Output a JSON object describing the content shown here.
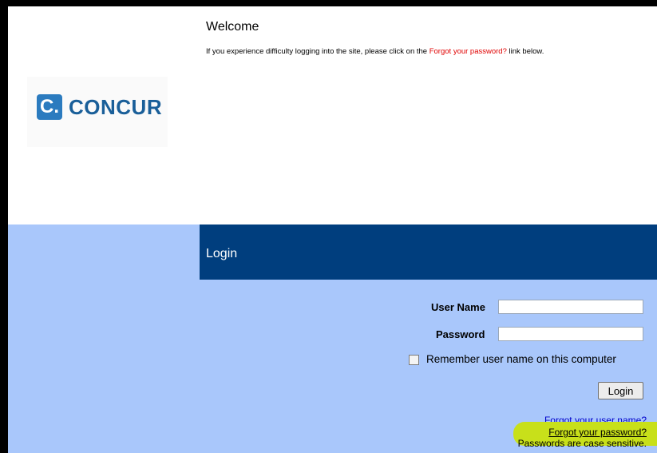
{
  "brand": {
    "logo_letter": "C.",
    "logo_text": "CONCUR"
  },
  "welcome": {
    "title": "Welcome",
    "text_before": "If you experience difficulty logging into the site, please click on the ",
    "link": "Forgot your password?",
    "text_after": " link below."
  },
  "login": {
    "header": "Login",
    "username_label": "User Name",
    "password_label": "Password",
    "remember_label": "Remember user name on this computer",
    "button_label": "Login",
    "forgot_username": "Forgot your user name?",
    "forgot_password": "Forgot your password?",
    "case_note": "Passwords are case sensitive."
  },
  "colors": {
    "header_blue": "#003e7e",
    "section_blue": "#a9c7fb",
    "highlight": "#c8e01a",
    "link_red": "#e00000"
  }
}
